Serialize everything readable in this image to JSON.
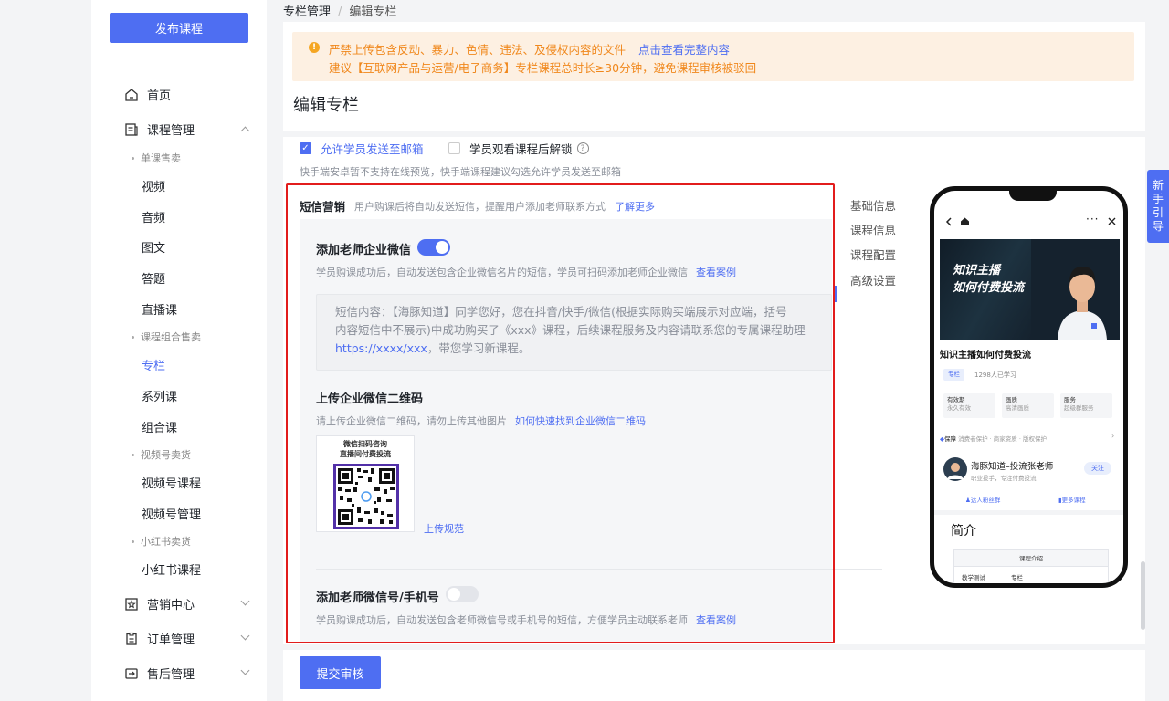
{
  "sidebar": {
    "publish_button": "发布课程",
    "home": "首页",
    "course_mgmt": "课程管理",
    "group_single": "单课售卖",
    "items_single": [
      "视频",
      "音频",
      "图文",
      "答题",
      "直播课"
    ],
    "group_combo": "课程组合售卖",
    "items_combo": [
      "专栏",
      "系列课",
      "组合课"
    ],
    "group_channels": "视频号卖货",
    "items_channels": [
      "视频号课程",
      "视频号管理"
    ],
    "group_xhs": "小红书卖货",
    "items_xhs": [
      "小红书课程"
    ],
    "marketing": "营销中心",
    "orders": "订单管理",
    "after_sale": "售后管理"
  },
  "breadcrumb": {
    "parent": "专栏管理",
    "separator": "/",
    "current": "编辑专栏"
  },
  "warning": {
    "line1": "严禁上传包含反动、暴力、色情、违法、及侵权内容的文件",
    "line1_link": "点击查看完整内容",
    "line2": "建议【互联网产品与运营/电子商务】专栏课程总时长≥30分钟，避免课程审核被驳回"
  },
  "page_title": "编辑专栏",
  "options": {
    "allow_email": "允许学员发送至邮箱",
    "allow_email_checked": true,
    "unlock_after_watch": "学员观看课程后解锁",
    "unlock_after_watch_checked": false,
    "hint": "快手端安卓暂不支持在线预览，快手端课程建议勾选允许学员发送至邮箱"
  },
  "sms": {
    "title": "短信营销",
    "desc": "用户购课后将自动发送短信，提醒用户添加老师联系方式",
    "learn_more": "了解更多",
    "wecom": {
      "label": "添加老师企业微信",
      "enabled": true,
      "hint": "学员购课成功后，自动发送包含企业微信名片的短信，学员可扫码添加老师企业微信",
      "case_link": "查看案例",
      "content_l1": "短信内容：【海豚知道】同学您好，您在抖音/快手/微信(根据实际购买端展示对应端，括号",
      "content_l2": "内容短信中不展示)中成功购买了《xxx》课程，后续课程服务及内容请联系您的专属课程助理",
      "content_url": "https://xxxx/xxx",
      "content_l3_rest": "，带您学习新课程。"
    },
    "qr": {
      "label": "上传企业微信二维码",
      "hint": "请上传企业微信二维码，请勿上传其他图片",
      "find_link": "如何快速找到企业微信二维码",
      "card_title1": "微信扫码咨询",
      "card_title2": "直播间付费投流",
      "spec_link": "上传规范"
    },
    "phone": {
      "label": "添加老师微信号/手机号",
      "enabled": false,
      "hint": "学员购课成功后，自动发送包含老师微信号或手机号的短信，方便学员主动联系老师",
      "case_link": "查看案例"
    }
  },
  "anchors": [
    "基础信息",
    "课程信息",
    "课程配置",
    "高级设置"
  ],
  "submit_button": "提交审核",
  "guide_tab": [
    "新",
    "手",
    "引",
    "导"
  ],
  "preview": {
    "hero_line1": "知识主播",
    "hero_line2": "如何付费投流",
    "course_title": "知识主播如何付费投流",
    "tag": "专栏",
    "learners": "1298人已学习",
    "features": [
      {
        "t": "有效期",
        "s": "永久有效"
      },
      {
        "t": "画质",
        "s": "高清画质"
      },
      {
        "t": "服务",
        "s": "超级群服务"
      }
    ],
    "guarantee_label": "保障",
    "guarantee_text": "消费者保护 · 商家资质 · 版权保护",
    "teacher_name": "海豚知道–投流张老师",
    "teacher_desc": "职业投手，专注付费投流",
    "follow": "关注",
    "fans_group": "达人粉丝群",
    "more_courses": "更多课程",
    "intro_heading": "简介",
    "table_header": "课程介绍",
    "row_label": "教学测试",
    "row_value": "专栏"
  },
  "colors": {
    "primary": "#4e6ef2",
    "warning_text": "#f0871b",
    "warning_bg": "#fdf0e2",
    "highlight_border": "#e21c1c"
  }
}
